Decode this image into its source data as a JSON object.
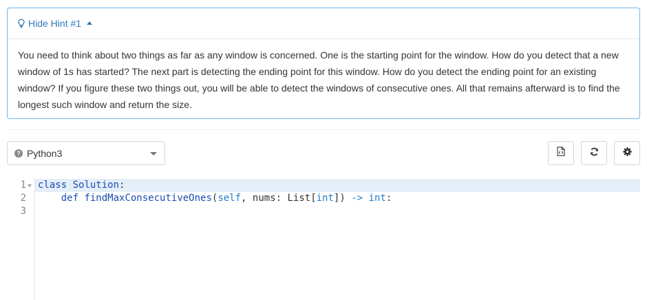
{
  "hint": {
    "title": "Hide Hint #1",
    "body": "You need to think about two things as far as any window is concerned. One is the starting point for the window. How do you detect that a new window of 1s has started? The next part is detecting the ending point for this window. How do you detect the ending point for an existing window? If you figure these two things out, you will be able to detect the windows of consecutive ones. All that remains afterward is to find the longest such window and return the size."
  },
  "toolbar": {
    "language": "Python3"
  },
  "editor": {
    "line_numbers": [
      "1",
      "2",
      "3"
    ],
    "line1": {
      "kw": "class",
      "name": "Solution",
      "colon": ":"
    },
    "line2": {
      "indent": "    ",
      "kw": "def",
      "fn": "findMaxConsecutiveOnes",
      "p1": "(",
      "self": "self",
      "p2": ", nums: List[",
      "t1": "int",
      "p3": "]) ",
      "arrow": "->",
      "sp": " ",
      "t2": "int",
      "colon": ":"
    }
  },
  "colors": {
    "accent": "#2f79b9",
    "keyword": "#1c4bb0",
    "active_line": "#e4eef8"
  },
  "icons": {
    "hint": "lightbulb-icon",
    "language_help": "question-circle-icon",
    "doc": "code-file-icon",
    "reset": "refresh-icon",
    "settings": "gear-icon"
  }
}
